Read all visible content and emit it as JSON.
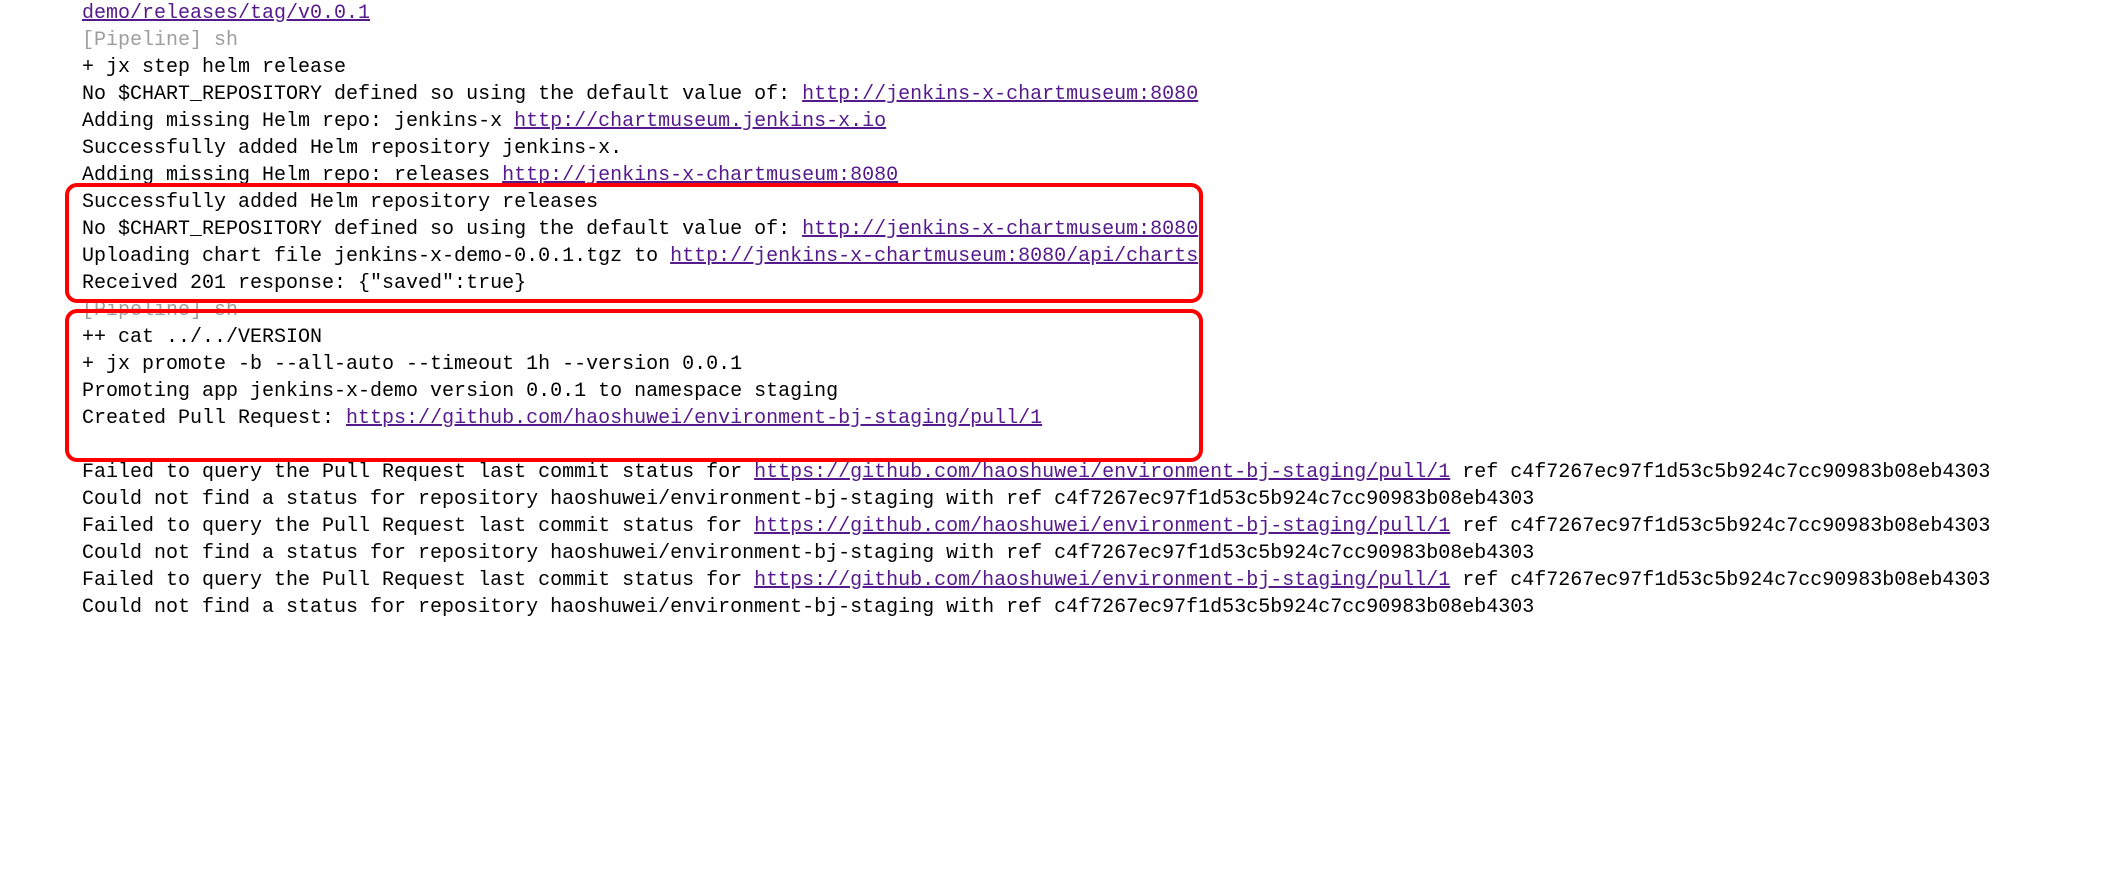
{
  "log": {
    "top_link": "demo/releases/tag/v0.0.1",
    "line1_pipeline": "[Pipeline] sh",
    "line2": "+ jx step helm release",
    "line3_prefix": "No $CHART_REPOSITORY defined so using the default value of: ",
    "line3_link": "http://jenkins-x-chartmuseum:8080",
    "line4_prefix": "Adding missing Helm repo: jenkins-x ",
    "line4_link": "http://chartmuseum.jenkins-x.io",
    "line5": "Successfully added Helm repository jenkins-x.",
    "line6_prefix": "Adding missing Helm repo: releases ",
    "line6_link": "http://jenkins-x-chartmuseum:8080",
    "line7": "Successfully added Helm repository releases",
    "line8_prefix": "No $CHART_REPOSITORY defined so using the default value of: ",
    "line8_link": "http://jenkins-x-chartmuseum:8080",
    "line9_prefix": "Uploading chart file jenkins-x-demo-0.0.1.tgz to ",
    "line9_link": "http://jenkins-x-chartmuseum:8080/api/charts",
    "line10": "Received 201 response: {\"saved\":true}",
    "line11_pipeline": "[Pipeline] sh",
    "line12": "++ cat ../../VERSION",
    "line13": "+ jx promote -b --all-auto --timeout 1h --version 0.0.1",
    "line14": "Promoting app jenkins-x-demo version 0.0.1 to namespace staging",
    "line15_prefix": "Created Pull Request: ",
    "line15_link": "https://github.com/haoshuwei/environment-bj-staging/pull/1",
    "fail_prefix": "Failed to query the Pull Request last commit status for ",
    "fail_link": "https://github.com/haoshuwei/environment-bj-staging/pull/1",
    "fail_suffix": " ref c4f7267ec97f1d53c5b924c7cc90983b08eb4303 Could not find a status for repository haoshuwei/environment-bj-staging with ref c4f7267ec97f1d53c5b924c7cc90983b08eb4303"
  }
}
